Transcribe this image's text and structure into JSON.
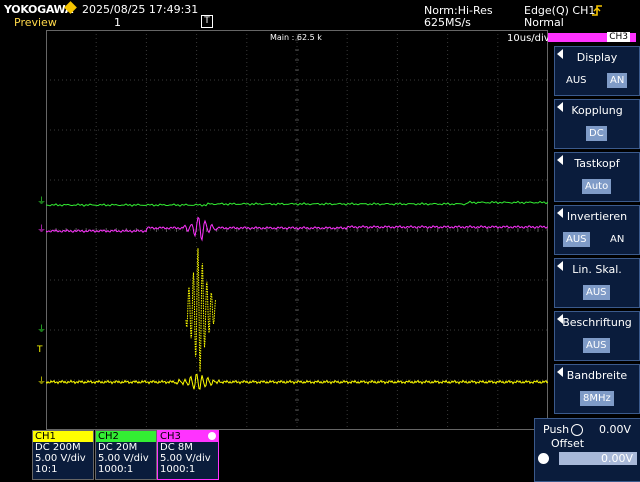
{
  "header": {
    "brand": "YOKOGAWA",
    "datetime": "2025/08/25 17:49:31",
    "preview_label": "Preview",
    "history_index": "1",
    "acq_mode": "Norm:Hi-Res",
    "sample_rate": "625MS/s",
    "trigger_type": "Edge(Q) CH1",
    "trigger_mode": "Normal",
    "trigger_pos_marker": "T"
  },
  "display": {
    "main_label": "Main : 62.5 k",
    "timebase": "10us/div",
    "active_channel_tab": "CH3"
  },
  "menu": {
    "display": {
      "title": "Display",
      "options": [
        "AUS",
        "AN"
      ],
      "selected": "AN"
    },
    "coupling": {
      "title": "Kopplung",
      "value": "DC"
    },
    "probe": {
      "title": "Tastkopf",
      "value": "Auto"
    },
    "invert": {
      "title": "Invertieren",
      "options": [
        "AUS",
        "AN"
      ],
      "selected": "AUS"
    },
    "linscale": {
      "title": "Lin. Skal.",
      "value": "AUS"
    },
    "label": {
      "title": "Beschriftung",
      "value": "AUS"
    },
    "bandwidth": {
      "title": "Bandbreite",
      "value": "8MHz"
    }
  },
  "offset": {
    "push_label": "Push",
    "value_top": "0.00V",
    "title": "Offset",
    "value_field": "0.00V"
  },
  "channels": [
    {
      "name": "CH1",
      "coupling": "DC 200M",
      "scale": "5.00 V/div",
      "probe": "10:1",
      "color": "#ffff00"
    },
    {
      "name": "CH2",
      "coupling": "DC 20M",
      "scale": "5.00 V/div",
      "probe": "1000:1",
      "color": "#33ee33"
    },
    {
      "name": "CH3",
      "coupling": "DC 8M",
      "scale": "5.00 V/div",
      "probe": "1000:1",
      "color": "#ff33ff"
    }
  ],
  "colors": {
    "ch1": "#ffff00",
    "ch2": "#33ee33",
    "ch3": "#ff33ff",
    "grid": "#444444",
    "panel": "#0a1c3c"
  }
}
